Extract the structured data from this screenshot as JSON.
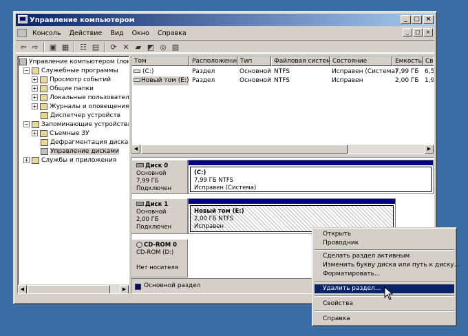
{
  "window": {
    "title": "Управление компьютером",
    "controls": [
      "_",
      "□",
      "×"
    ]
  },
  "menubar": {
    "items": [
      "Консоль",
      "Действие",
      "Вид",
      "Окно",
      "Справка"
    ],
    "mdi_controls": [
      "_",
      "□",
      "×"
    ]
  },
  "toolbar": {
    "icons": [
      "back-icon",
      "forward-icon",
      "up-folder-icon",
      "show-tree-icon",
      "properties-icon",
      "help-icon",
      "refresh-icon",
      "delete-icon",
      "open-icon",
      "search-icon",
      "disk-icon",
      "format-icon"
    ]
  },
  "tree": {
    "root": "Управление компьютером (локал",
    "items": [
      {
        "label": "Служебные программы",
        "level": 1,
        "expander": "−"
      },
      {
        "label": "Просмотр событий",
        "level": 2,
        "expander": "+"
      },
      {
        "label": "Общие папки",
        "level": 2,
        "expander": "+"
      },
      {
        "label": "Локальные пользователи",
        "level": 2,
        "expander": "+"
      },
      {
        "label": "Журналы и оповещения пр",
        "level": 2,
        "expander": "+"
      },
      {
        "label": "Диспетчер устройств",
        "level": 2,
        "expander": ""
      },
      {
        "label": "Запоминающие устройства",
        "level": 1,
        "expander": "−"
      },
      {
        "label": "Съемные ЗУ",
        "level": 2,
        "expander": "+"
      },
      {
        "label": "Дефрагментация диска",
        "level": 2,
        "expander": ""
      },
      {
        "label": "Управление дисками",
        "level": 2,
        "expander": "",
        "selected": true
      },
      {
        "label": "Службы и приложения",
        "level": 1,
        "expander": "+"
      }
    ]
  },
  "volumes": {
    "columns": [
      "Том",
      "Расположение",
      "Тип",
      "Файловая система",
      "Состояние",
      "Емкость",
      "Сво"
    ],
    "rows": [
      [
        "(C:)",
        "Раздел",
        "Основной",
        "NTFS",
        "Исправен (Система)",
        "7,99 ГБ",
        "6,5"
      ],
      [
        "Новый том (E:)",
        "Раздел",
        "Основной",
        "NTFS",
        "Исправен",
        "2,00 ГБ",
        "1,9"
      ]
    ]
  },
  "disks": [
    {
      "name": "Диск 0",
      "type": "Основной",
      "size": "7,99 ГБ",
      "status": "Подключен",
      "partition": {
        "name": "(C:)",
        "size_fs": "7,99 ГБ NTFS",
        "status": "Исправен (Система)"
      }
    },
    {
      "name": "Диск 1",
      "type": "Основной",
      "size": "2,00 ГБ",
      "status": "Подключен",
      "partition": {
        "name": "Новый том  (E:)",
        "size_fs": "2,00 ГБ NTFS",
        "status": "Исправен"
      }
    },
    {
      "name": "CD-ROM 0",
      "type": "CD-ROM (D:)",
      "size": "",
      "status": "Нет носителя"
    }
  ],
  "legend": {
    "primary_partition": "Основной раздел",
    "color": "#000080"
  },
  "context_menu": {
    "items": [
      "Открыть",
      "Проводник",
      "Сделать раздел активным",
      "Изменить букву диска или путь к диску...",
      "Форматировать...",
      "Удалить раздел...",
      "Свойства",
      "Справка"
    ],
    "highlighted": "Удалить раздел..."
  },
  "colors": {
    "desktop": "#3a6ea5",
    "title_active": "#0a246a",
    "face": "#d4d0c8",
    "primary": "#000080"
  }
}
